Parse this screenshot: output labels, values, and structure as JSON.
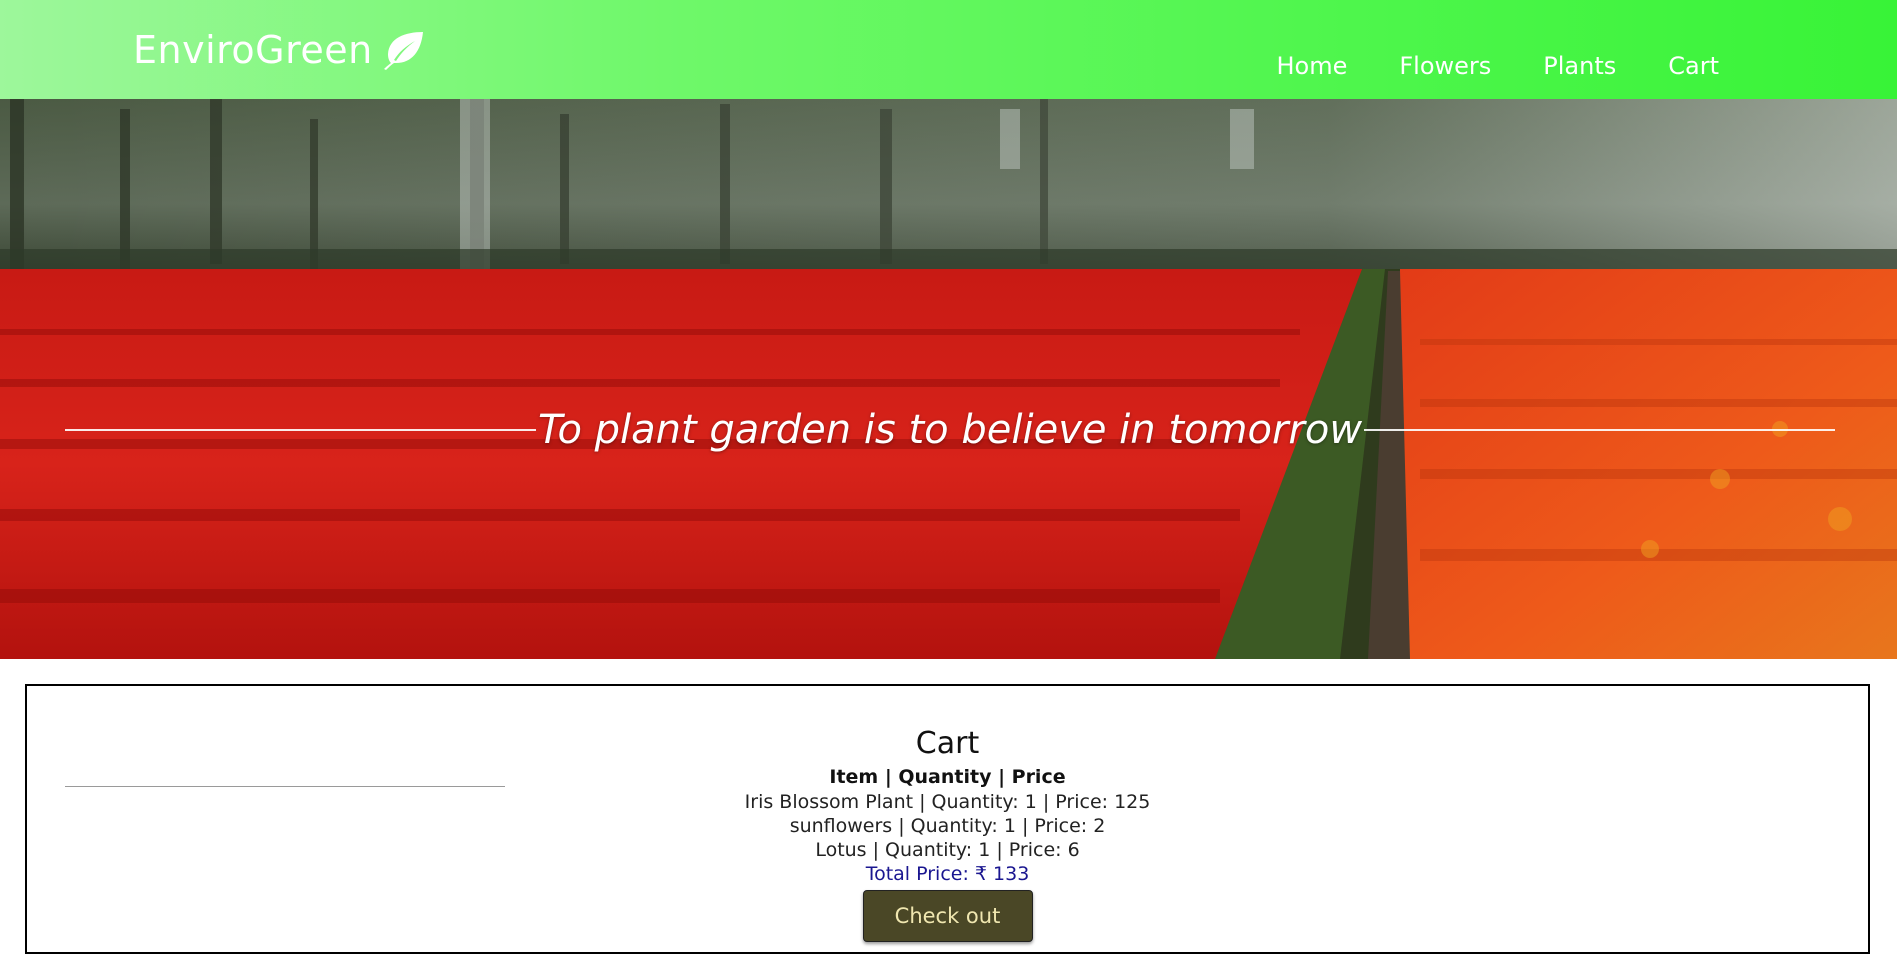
{
  "brand": {
    "name": "EnviroGreen",
    "icon": "leaf-icon"
  },
  "nav": {
    "items": [
      "Home",
      "Flowers",
      "Plants",
      "Cart"
    ]
  },
  "hero": {
    "tagline": "To plant garden is to believe in tomorrow"
  },
  "cart": {
    "title": "Cart",
    "header": "Item | Quantity | Price",
    "items": [
      "Iris Blossom Plant | Quantity: 1 | Price: 125",
      "sunflowers | Quantity: 1 | Price: 2",
      "Lotus | Quantity: 1 | Price: 6"
    ],
    "total": "Total Price: ₹ 133",
    "checkout_label": "Check out"
  },
  "colors": {
    "nav_gradient_start": "#9df79b",
    "nav_gradient_end": "#38f337",
    "total_text": "#1a1690",
    "checkout_bg": "#4a4726"
  }
}
